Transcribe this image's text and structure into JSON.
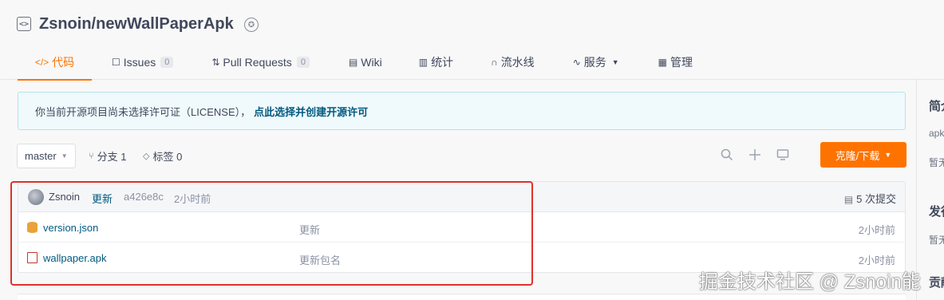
{
  "repo": {
    "title": "Zsnoin/newWallPaperApk"
  },
  "tabs": [
    {
      "icon": "</>",
      "label": "代码"
    },
    {
      "icon": "☐",
      "label": "Issues",
      "count": "0"
    },
    {
      "icon": "⇅",
      "label": "Pull Requests",
      "count": "0"
    },
    {
      "icon": "▤",
      "label": "Wiki"
    },
    {
      "icon": "▥",
      "label": "统计"
    },
    {
      "icon": "∩",
      "label": "流水线"
    },
    {
      "icon": "∿",
      "label": "服务"
    },
    {
      "icon": "▦",
      "label": "管理"
    }
  ],
  "notice": {
    "text": "你当前开源项目尚未选择许可证（LICENSE），",
    "link": "点此选择并创建开源许可"
  },
  "toolbar": {
    "branch": "master",
    "branches_label": "分支 1",
    "tags_label": "标签 0",
    "clone_label": "克隆/下载"
  },
  "commit": {
    "author": "Zsnoin",
    "message": "更新",
    "hash": "a426e8c",
    "time": "2小时前",
    "count_label": "5 次提交"
  },
  "files": [
    {
      "name": "version.json",
      "message": "更新",
      "time": "2小时前",
      "icon": "database-icon"
    },
    {
      "name": "wallpaper.apk",
      "message": "更新包名",
      "time": "2小时前",
      "icon": "file-icon"
    }
  ],
  "sidebar": {
    "intro_heading": "简介",
    "intro_text": "apk",
    "intro_none": "暂无",
    "release_heading": "发行",
    "release_none": "暂无",
    "contrib_heading": "贡献"
  },
  "watermark": "掘金技术社区 @ Zsnoin能",
  "colors": {
    "accent": "#fe7300",
    "link": "#005980",
    "annotation": "#e0312a"
  }
}
